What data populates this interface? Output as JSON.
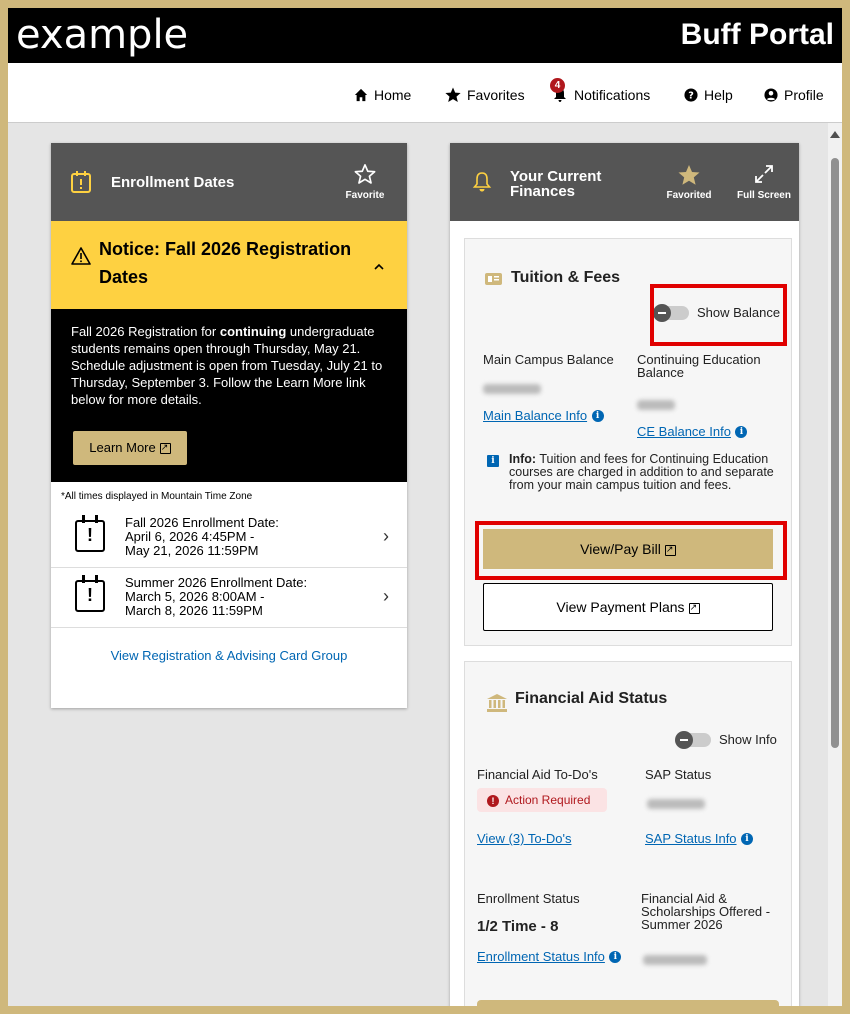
{
  "header": {
    "example_label": "example",
    "portal_title": "Buff Portal"
  },
  "nav": {
    "home": "Home",
    "favorites": "Favorites",
    "notifications": "Notifications",
    "notification_count": "4",
    "help": "Help",
    "profile": "Profile"
  },
  "enrollment": {
    "title": "Enrollment Dates",
    "favorite_label": "Favorite",
    "notice_title": "Notice: Fall 2026 Registration Dates",
    "notice_body_1": "Fall 2026 Registration for ",
    "notice_body_bold": "continuing",
    "notice_body_2": " undergraduate students remains open through Thursday, May 21. Schedule adjustment is open from Tuesday, July 21 to Thursday, September 3. Follow the Learn More link below for more details.",
    "learn_more": "Learn More",
    "timezone_note": "*All times displayed in Mountain Time Zone",
    "rows": [
      {
        "line1": "Fall 2026 Enrollment Date:",
        "line2": "April 6, 2026 4:45PM -",
        "line3": "May 21, 2026 11:59PM"
      },
      {
        "line1": "Summer 2026 Enrollment Date:",
        "line2": "March 5, 2026 8:00AM -",
        "line3": "March 8, 2026 11:59PM"
      }
    ],
    "view_group_link": "View Registration & Advising Card Group"
  },
  "finances": {
    "title_line1": "Your Current",
    "title_line2": "Finances",
    "favorited_label": "Favorited",
    "fullscreen_label": "Full Screen",
    "tuition": {
      "title": "Tuition & Fees",
      "show_balance": "Show Balance",
      "main_label": "Main Campus Balance",
      "ce_label": "Continuing Education Balance",
      "main_link": "Main Balance Info",
      "ce_link": "CE Balance Info",
      "info_bold": "Info:",
      "info_text": " Tuition and fees for Continuing Education courses are charged in addition to and separate from your main campus tuition and fees.",
      "pay_button": "View/Pay Bill",
      "plans_button": "View Payment Plans"
    },
    "aid": {
      "title": "Financial Aid Status",
      "show_info": "Show Info",
      "todo_label": "Financial Aid To-Do's",
      "sap_label": "SAP Status",
      "action_required": "Action Required",
      "todo_link": "View (3) To-Do's",
      "sap_link": "SAP Status Info",
      "enrollment_label": "Enrollment Status",
      "offered_label": "Financial Aid & Scholarships Offered - Summer 2026",
      "enrollment_value": "1/2 Time - 8",
      "enrollment_link": "Enrollment Status Info"
    }
  }
}
